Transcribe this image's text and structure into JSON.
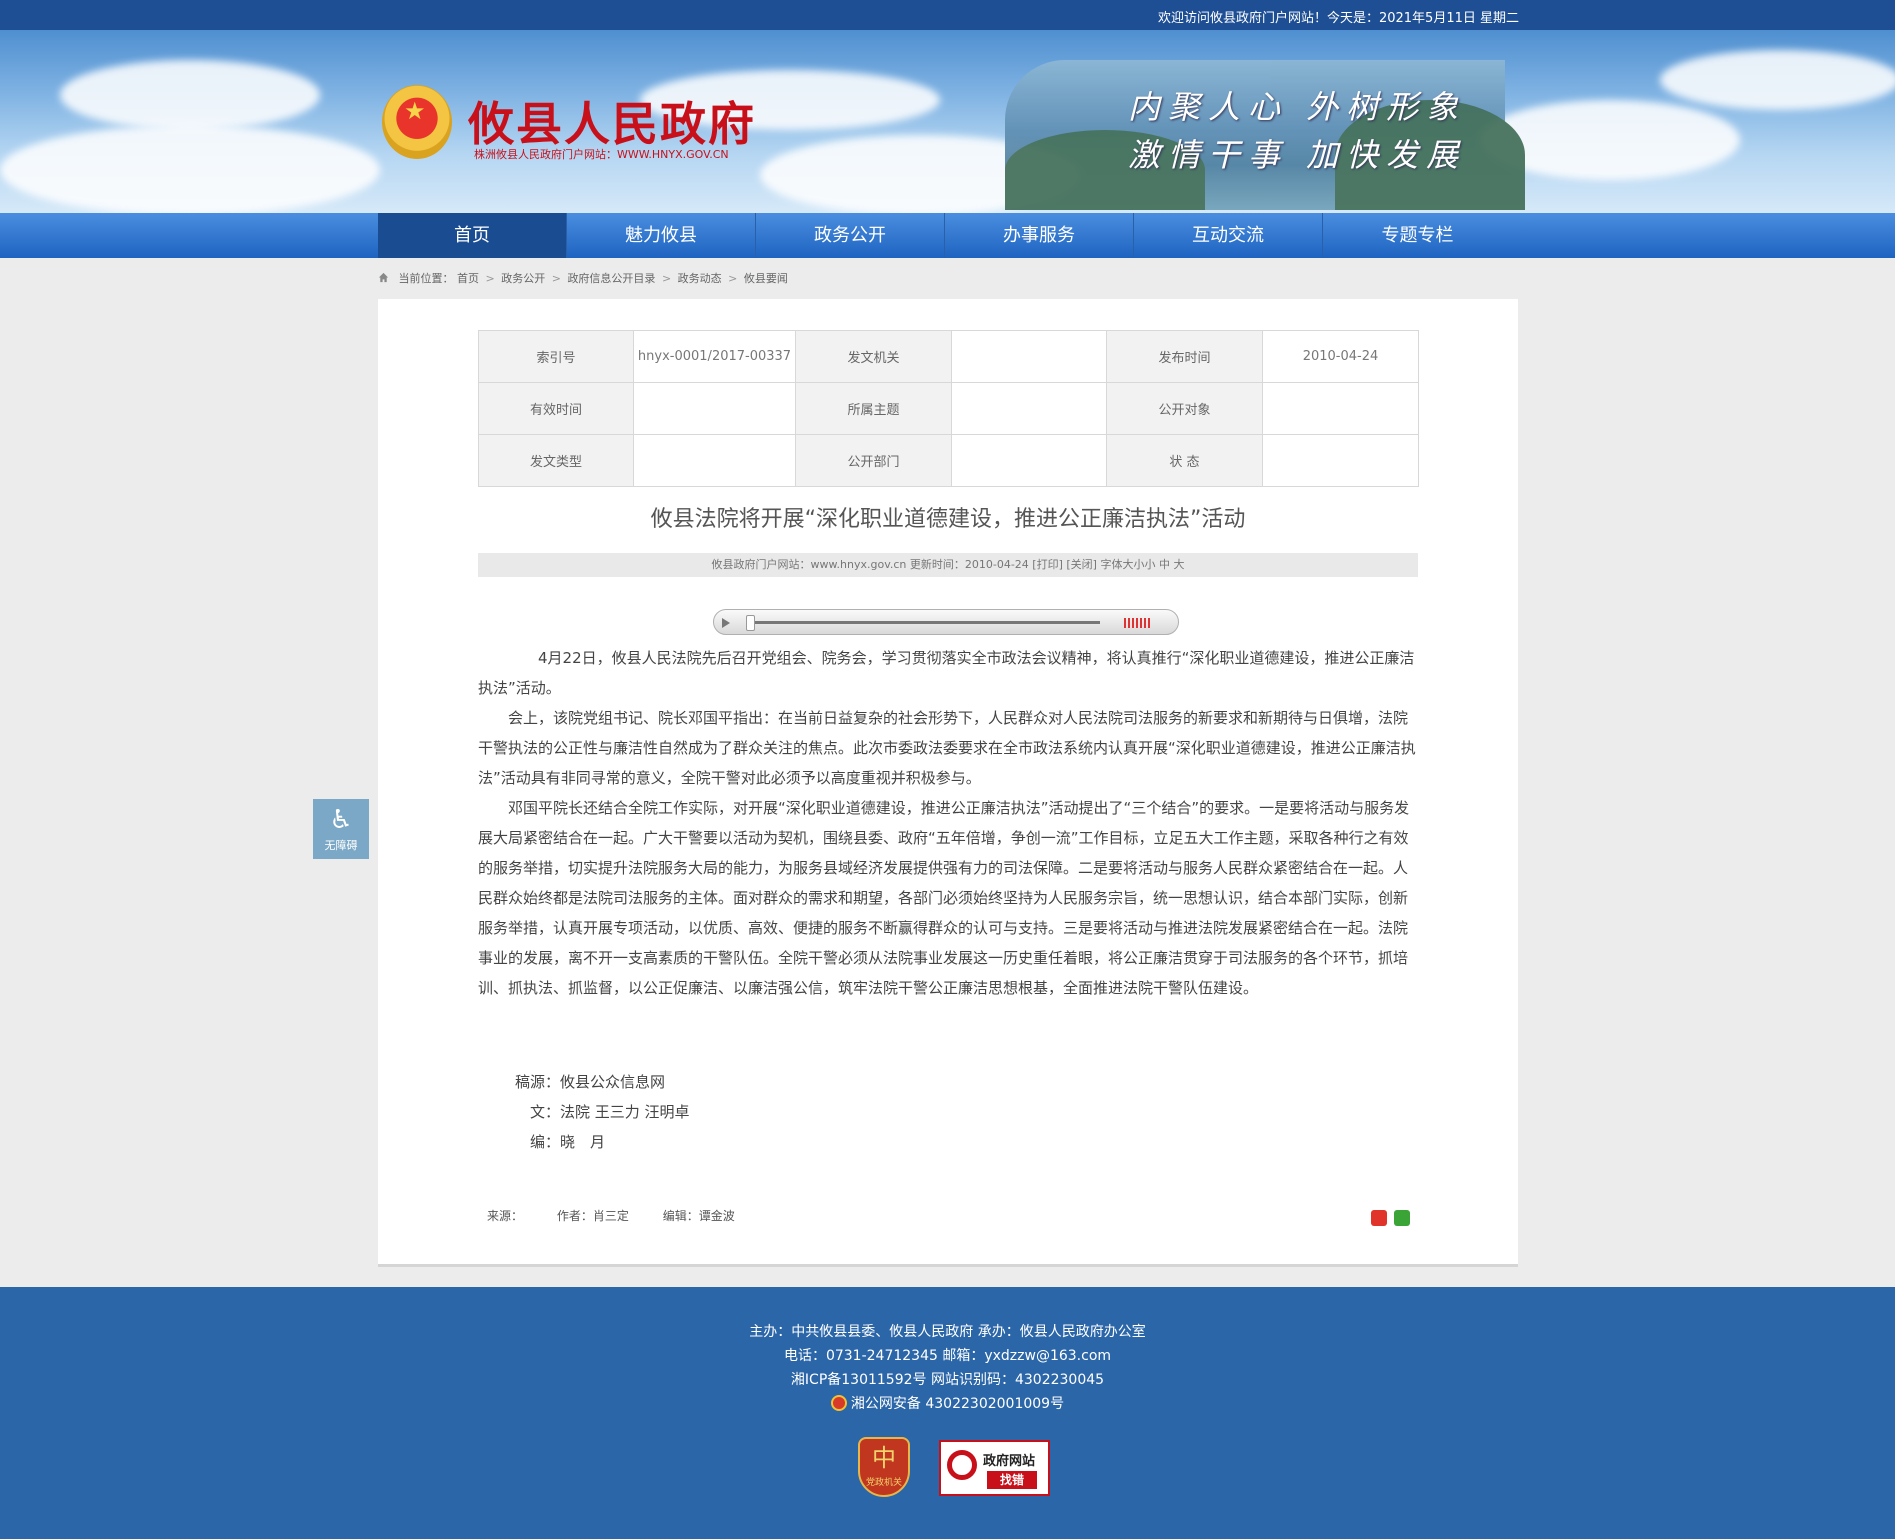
{
  "topbar": {
    "welcome": "欢迎访问攸县政府门户网站！今天是：2021年5月11日 星期二"
  },
  "header": {
    "site_name": "攸县人民政府",
    "site_url": "株洲攸县人民政府门户网站：WWW.HNYX.GOV.CN",
    "slogan_line1": "内聚人心  外树形象",
    "slogan_line2": "激情干事  加快发展"
  },
  "nav": {
    "items": [
      {
        "label": "首页"
      },
      {
        "label": "魅力攸县"
      },
      {
        "label": "政务公开"
      },
      {
        "label": "办事服务"
      },
      {
        "label": "互动交流"
      },
      {
        "label": "专题专栏"
      }
    ]
  },
  "breadcrumb": {
    "prefix": "当前位置：",
    "items": [
      "首页",
      "政务公开",
      "政府信息公开目录",
      "政务动态",
      "攸县要闻"
    ],
    "separator": ">"
  },
  "meta": {
    "rows": [
      [
        {
          "k": "索引号",
          "v": "hnyx-0001/2017-00337"
        },
        {
          "k": "发文机关",
          "v": ""
        },
        {
          "k": "发布时间",
          "v": "2010-04-24"
        }
      ],
      [
        {
          "k": "有效时间",
          "v": ""
        },
        {
          "k": "所属主题",
          "v": ""
        },
        {
          "k": "公开对象",
          "v": ""
        }
      ],
      [
        {
          "k": "发文类型",
          "v": ""
        },
        {
          "k": "公开部门",
          "v": ""
        },
        {
          "k": "状 态",
          "v": ""
        }
      ]
    ]
  },
  "article": {
    "title": "攸县法院将开展“深化职业道德建设，推进公正廉洁执法”活动",
    "info": "攸县政府门户网站：www.hnyx.gov.cn   更新时间：2010-04-24   [打印]  [关闭]   字体大小小 中 大",
    "paragraphs": [
      "4月22日，攸县人民法院先后召开党组会、院务会，学习贯彻落实全市政法会议精神，将认真推行“深化职业道德建设，推进公正廉洁执法”活动。",
      "会上，该院党组书记、院长邓国平指出：在当前日益复杂的社会形势下，人民群众对人民法院司法服务的新要求和新期待与日俱增，法院干警执法的公正性与廉洁性自然成为了群众关注的焦点。此次市委政法委要求在全市政法系统内认真开展“深化职业道德建设，推进公正廉洁执法”活动具有非同寻常的意义，全院干警对此必须予以高度重视并积极参与。",
      "邓国平院长还结合全院工作实际，对开展“深化职业道德建设，推进公正廉洁执法”活动提出了“三个结合”的要求。一是要将活动与服务发展大局紧密结合在一起。广大干警要以活动为契机，围绕县委、政府“五年倍增，争创一流”工作目标，立足五大工作主题，采取各种行之有效的服务举措，切实提升法院服务大局的能力，为服务县域经济发展提供强有力的司法保障。二是要将活动与服务人民群众紧密结合在一起。人民群众始终都是法院司法服务的主体。面对群众的需求和期望，各部门必须始终坚持为人民服务宗旨，统一思想认识，结合本部门实际，创新服务举措，认真开展专项活动，以优质、高效、便捷的服务不断赢得群众的认可与支持。三是要将活动与推进法院发展紧密结合在一起。法院事业的发展，离不开一支高素质的干警队伍。全院干警必须从法院事业发展这一历史重任着眼，将公正廉洁贯穿于司法服务的各个环节，抓培训、抓执法、抓监督，以公正促廉洁、以廉洁强公信，筑牢法院干警公正廉洁思想根基，全面推进法院干警队伍建设。"
    ],
    "credits": [
      "稿源：攸县公众信息网",
      "　文：法院 王三力 汪明卓",
      "　编：晓　月"
    ],
    "footline": {
      "source": "来源：",
      "author": "作者：肖三定",
      "editor": "编辑：谭金波"
    }
  },
  "accessibility": {
    "label": "无障碍"
  },
  "footer": {
    "line1": "主办：中共攸县县委、攸县人民政府 承办：攸县人民政府办公室",
    "line2": "电话：0731-24712345 邮箱：yxdzzw@163.com",
    "line3": "湘ICP备13011592号   网站识别码：4302230045",
    "line4": "湘公网安备 43022302001009号",
    "badge1_big": "中",
    "badge1_small": "党政机关",
    "badge2_title": "政府网站",
    "badge2_action": "找错"
  },
  "colors": {
    "nav": "#1d63c0",
    "nav_active": "#1a4c91",
    "footer": "#2b66a8",
    "brand_red": "#c8101a"
  }
}
